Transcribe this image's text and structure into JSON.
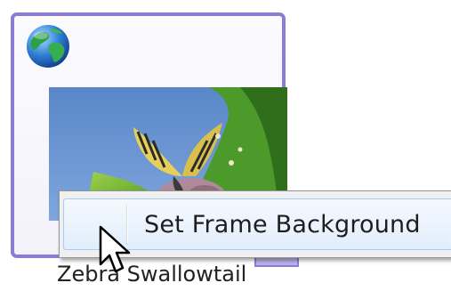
{
  "thumbnail": {
    "caption": "Zebra Swallowtail",
    "badge_icon": "globe-icon",
    "photo_subject": "butterfly-photo",
    "selection_color": "#8c7cd6"
  },
  "context_menu": {
    "items": [
      {
        "label": "Set Frame Background",
        "state": "hover"
      }
    ]
  },
  "cursor": {
    "icon": "arrow-cursor-icon"
  }
}
